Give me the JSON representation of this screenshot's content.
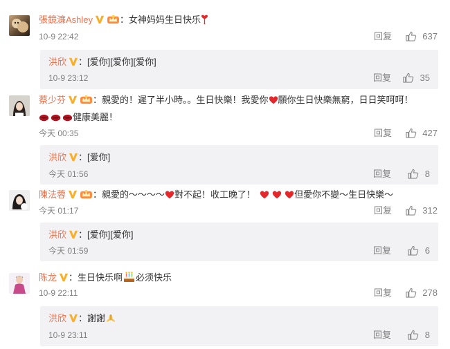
{
  "comments": [
    {
      "user": "張鏡濂Ashley",
      "text": "女神妈妈生日快乐",
      "time": "10-9 22:42",
      "reply_label": "回复",
      "likes": "637",
      "reply": {
        "user": "洪欣",
        "text": "[爱你][爱你][爱你]",
        "time": "10-9 23:12",
        "reply_label": "回复",
        "likes": "35"
      }
    },
    {
      "user": "蔡少芬",
      "text": "親愛的！遲了半小時。。生日快樂！我愛你",
      "text_after_heart": "願你生日快樂無窮，日日笑呵呵！",
      "text_line2": "健康美麗！",
      "time": "今天 00:35",
      "reply_label": "回复",
      "likes": "427",
      "reply": {
        "user": "洪欣",
        "text": "[爱你]",
        "time": "今天 01:56",
        "reply_label": "回复",
        "likes": "8"
      }
    },
    {
      "user": "陳法蓉",
      "text": "親愛的～～～～",
      "text_mid": "對不起！收工晚了！",
      "text_end": "但愛你不變～生日快樂～",
      "time": "今天 01:17",
      "reply_label": "回复",
      "likes": "312",
      "reply": {
        "user": "洪欣",
        "text": "[爱你][爱你]",
        "time": "今天 01:59",
        "reply_label": "回复",
        "likes": "6"
      }
    },
    {
      "user": "陈龙",
      "text": "生日快乐啊",
      "text_after_cake": "必须快乐",
      "time": "10-9 22:11",
      "reply_label": "回复",
      "likes": "278",
      "reply": {
        "user": "洪欣",
        "text": "謝謝",
        "time": "10-9 23:11",
        "reply_label": "回复",
        "likes": "8"
      }
    }
  ],
  "colors": {
    "username": "#eb7350",
    "muted": "#808080",
    "reply_bg": "#f2f2f5",
    "vip_badge": "#f8b02c"
  },
  "icons": [
    "vip-badge-icon",
    "member-crown-icon",
    "thumbs-up-icon",
    "red-heart-emoji",
    "lips-emoji",
    "cake-emoji",
    "pray-emoji"
  ]
}
